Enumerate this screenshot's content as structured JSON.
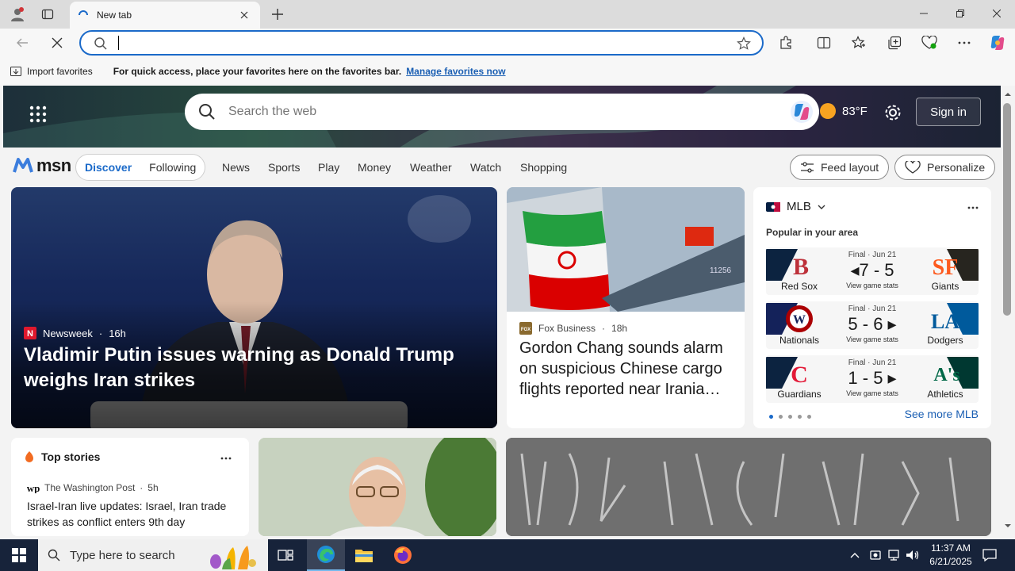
{
  "browser": {
    "tab_title": "New tab",
    "favorites_bar": {
      "import_label": "Import favorites",
      "hint": "For quick access, place your favorites here on the favorites bar.",
      "manage_link": "Manage favorites now"
    },
    "address_value": ""
  },
  "msn": {
    "search_placeholder": "Search the web",
    "weather": "83°F",
    "sign_in": "Sign in",
    "logo_text": "msn",
    "feed_tabs": [
      "Discover",
      "Following"
    ],
    "nav_links": [
      "News",
      "Sports",
      "Play",
      "Money",
      "Weather",
      "Watch",
      "Shopping"
    ],
    "feed_layout_label": "Feed layout",
    "personalize_label": "Personalize"
  },
  "main_story": {
    "source": "Newsweek",
    "age": "16h",
    "headline": "Vladimir Putin issues warning as Donald Trump weighs Iran strikes"
  },
  "second_story": {
    "source": "Fox Business",
    "age": "18h",
    "headline": "Gordon Chang sounds alarm on suspicious Chinese cargo flights reported near Irania…"
  },
  "mlb": {
    "title": "MLB",
    "subtitle": "Popular in your area",
    "see_more": "See more MLB",
    "games": [
      {
        "status": "Final · Jun 21",
        "score": "7 - 5",
        "stats": "View game stats",
        "home": "Red Sox",
        "away": "Giants",
        "home_color": "#0c2340",
        "away_color": "#27251f"
      },
      {
        "status": "Final · Jun 21",
        "score": "5 - 6",
        "stats": "View game stats",
        "home": "Nationals",
        "away": "Dodgers",
        "home_color": "#14225a",
        "away_color": "#005a9c"
      },
      {
        "status": "Final · Jun 21",
        "score": "1 - 5",
        "stats": "View game stats",
        "home": "Guardians",
        "away": "Athletics",
        "home_color": "#0c2340",
        "away_color": "#003831"
      }
    ]
  },
  "top_stories": {
    "title": "Top stories",
    "source": "The Washington Post",
    "age": "5h",
    "headline": "Israel-Iran live updates: Israel, Iran trade strikes as conflict enters 9th day"
  },
  "taskbar": {
    "search_placeholder": "Type here to search",
    "time": "11:37 AM",
    "date": "6/21/2025"
  }
}
